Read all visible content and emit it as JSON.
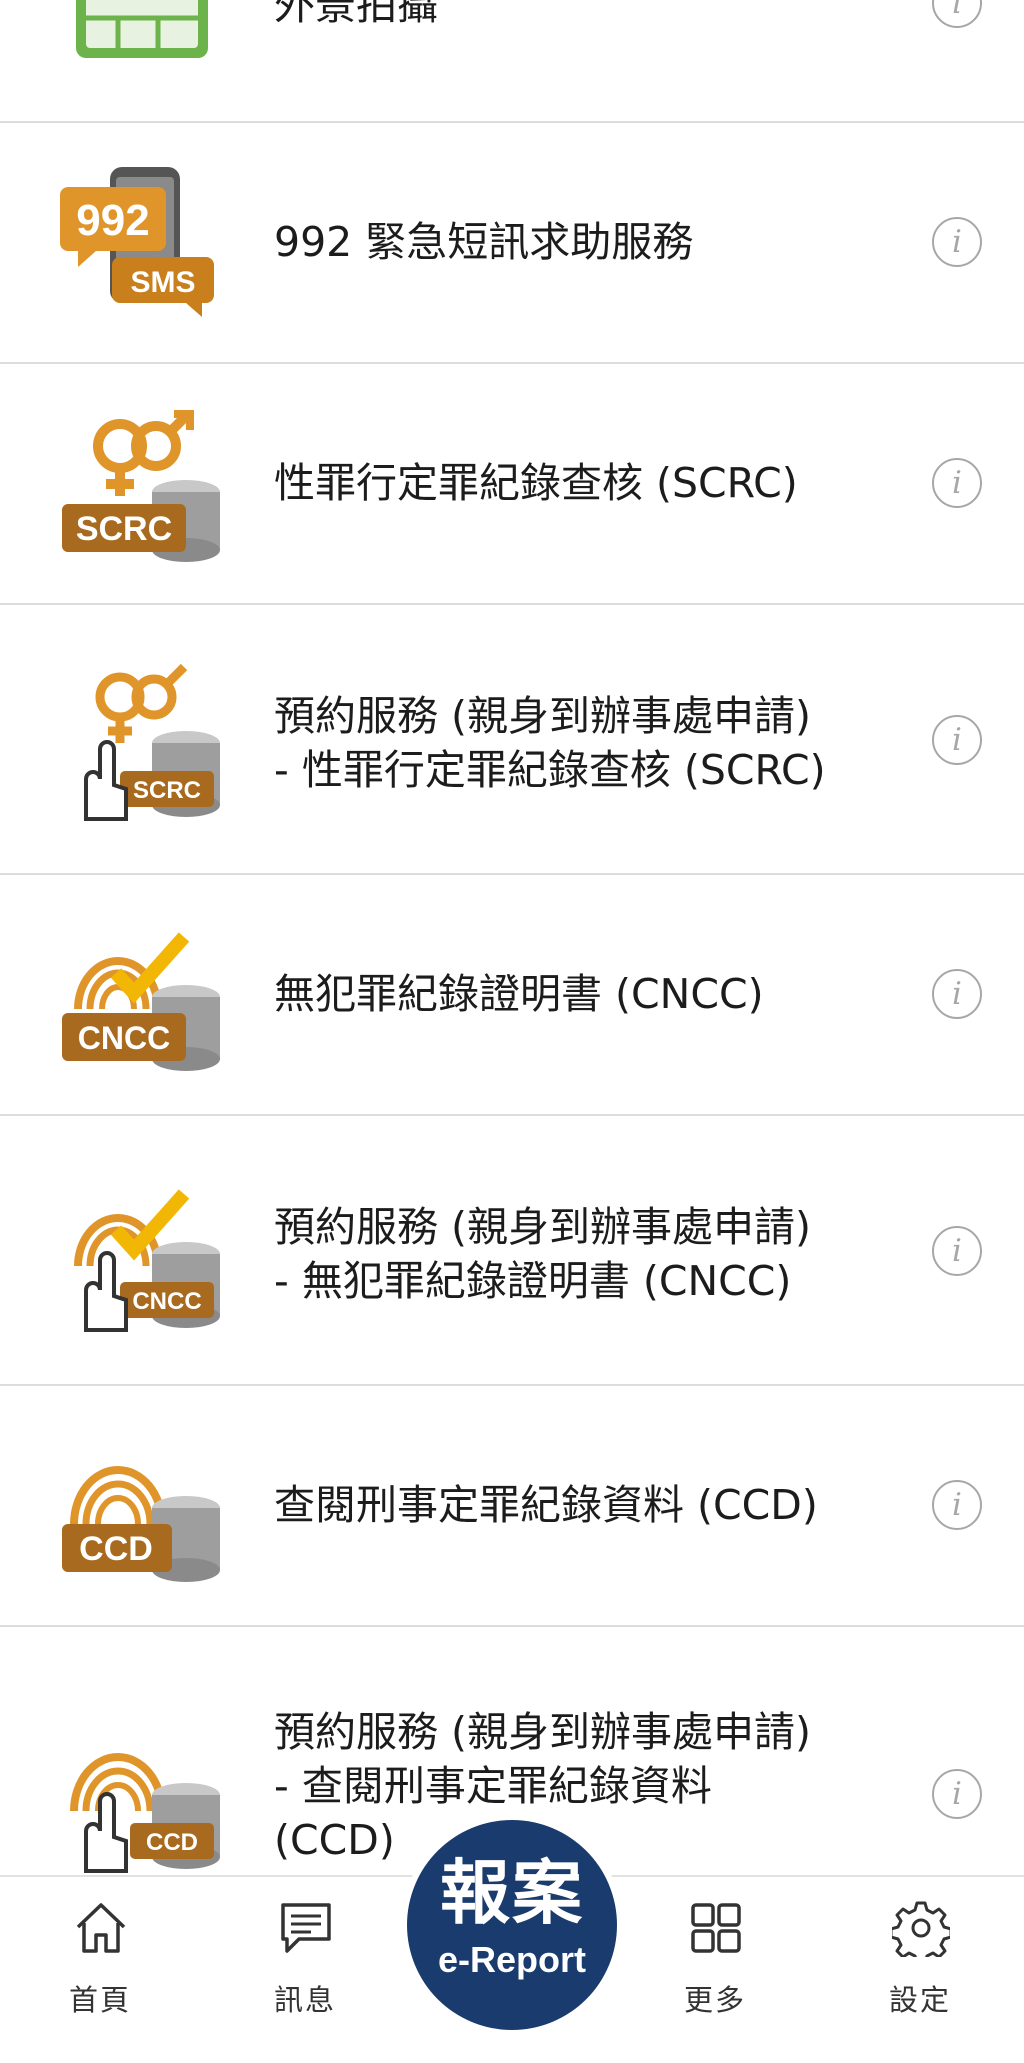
{
  "services": [
    {
      "label": "外景拍攝",
      "icon": "camera-screen-icon"
    },
    {
      "label": "992 緊急短訊求助服務",
      "icon": "992-sms-icon"
    },
    {
      "label": "性罪行定罪紀錄查核 (SCRC)",
      "icon": "scrc-database-icon"
    },
    {
      "label": "預約服務 (親身到辦事處申請)\n- 性罪行定罪紀錄查核 (SCRC)",
      "icon": "scrc-appointment-icon"
    },
    {
      "label": "無犯罪紀錄證明書 (CNCC)",
      "icon": "cncc-database-icon"
    },
    {
      "label": "預約服務 (親身到辦事處申請)\n- 無犯罪紀錄證明書 (CNCC)",
      "icon": "cncc-appointment-icon"
    },
    {
      "label": "查閱刑事定罪紀錄資料 (CCD)",
      "icon": "ccd-database-icon"
    },
    {
      "label": "預約服務 (親身到辦事處申請)\n- 查閱刑事定罪紀錄資料\n(CCD)",
      "icon": "ccd-appointment-icon"
    }
  ],
  "icon_badges": {
    "sms_top": "992",
    "sms_bottom": "SMS",
    "scrc": "SCRC",
    "cncc": "CNCC",
    "ccd": "CCD"
  },
  "info_glyph": "i",
  "tabbar": {
    "home": "首頁",
    "messages": "訊息",
    "report_zh": "報案",
    "report_en": "e-Report",
    "more": "更多",
    "settings": "設定"
  },
  "colors": {
    "accent_gold": "#e0952a",
    "report_blue": "#1a3b6e",
    "divider": "#dcdcdc",
    "info_gray": "#a7a7a7"
  }
}
